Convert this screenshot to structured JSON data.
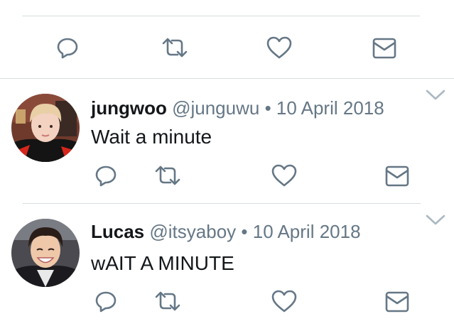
{
  "colors": {
    "icon": "#657786",
    "divider": "#d5dde3",
    "text": "#14171a",
    "muted": "#657786"
  },
  "top_actions": {
    "icons": [
      "reply-icon",
      "retweet-icon",
      "like-icon",
      "direct-message-icon"
    ]
  },
  "tweets": [
    {
      "display_name": "jungwoo",
      "handle": "@junguwu",
      "separator": "•",
      "date": "10 April 2018",
      "text": "Wait a minute",
      "avatar": "jungwoo-avatar"
    },
    {
      "display_name": "Lucas",
      "handle": "@itsyaboy",
      "separator": "•",
      "date": "10 April 2018",
      "text": "wAIT A MINUTE",
      "avatar": "lucas-avatar"
    }
  ]
}
